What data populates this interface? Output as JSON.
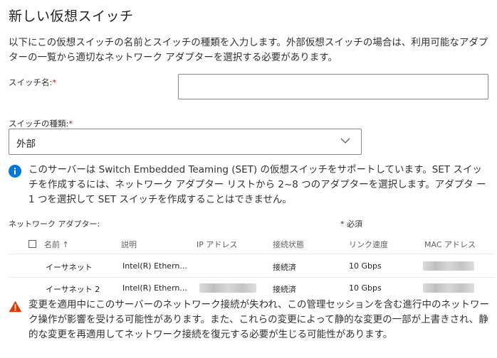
{
  "title": "新しい仮想スイッチ",
  "description": "以下にこの仮想スイッチの名前とスイッチの種類を入力します。外部仮想スイッチの場合は、利用可能なアダプターの一覧から適切なネットワーク アダプターを選択する必要があります。",
  "switch_name": {
    "label": "スイッチ名:",
    "required_mark": "*",
    "value": ""
  },
  "switch_type": {
    "label": "スイッチの種類:",
    "required_mark": "*",
    "selected": "外部"
  },
  "info_message": "このサーバーは Switch Embedded Teaming (SET) の仮想スイッチをサポートしています。SET スイッチを作成するには、ネットワーク アダプター リストから 2~8 つのアダプターを選択します。アダプタ ー1 つを選択して SET スイッチを作成することはできません。",
  "adapters": {
    "label": "ネットワーク アダプター:",
    "required_note": "* 必須",
    "columns": {
      "name": "名前",
      "sort_indicator": "↑",
      "description": "説明",
      "ip": "IP アドレス",
      "status": "接続状態",
      "speed": "リンク速度",
      "mac": "MAC アドレス"
    },
    "rows": [
      {
        "name": "イーサネット",
        "description": "Intel(R) Ethern...",
        "ip": "",
        "status": "接続済",
        "speed": "10 Gbps"
      },
      {
        "name": "イーサネット 2",
        "description": "Intel(R) Ethern...",
        "ip": "",
        "status": "接続済",
        "speed": "10 Gbps"
      }
    ]
  },
  "warning_message": "変更を適用中にこのサーバーのネットワーク接続が失われ、この管理セッションを含む進行中のネットワーク操作が影響を受ける可能性があります。また、これらの変更によって静的な変更の一部が上書きされ、静的な変更を再適用してネットワーク接続を復元する必要が生じる可能性があります。",
  "colors": {
    "info": "#0078d4",
    "warning": "#d83b01",
    "required": "#a4262c"
  }
}
